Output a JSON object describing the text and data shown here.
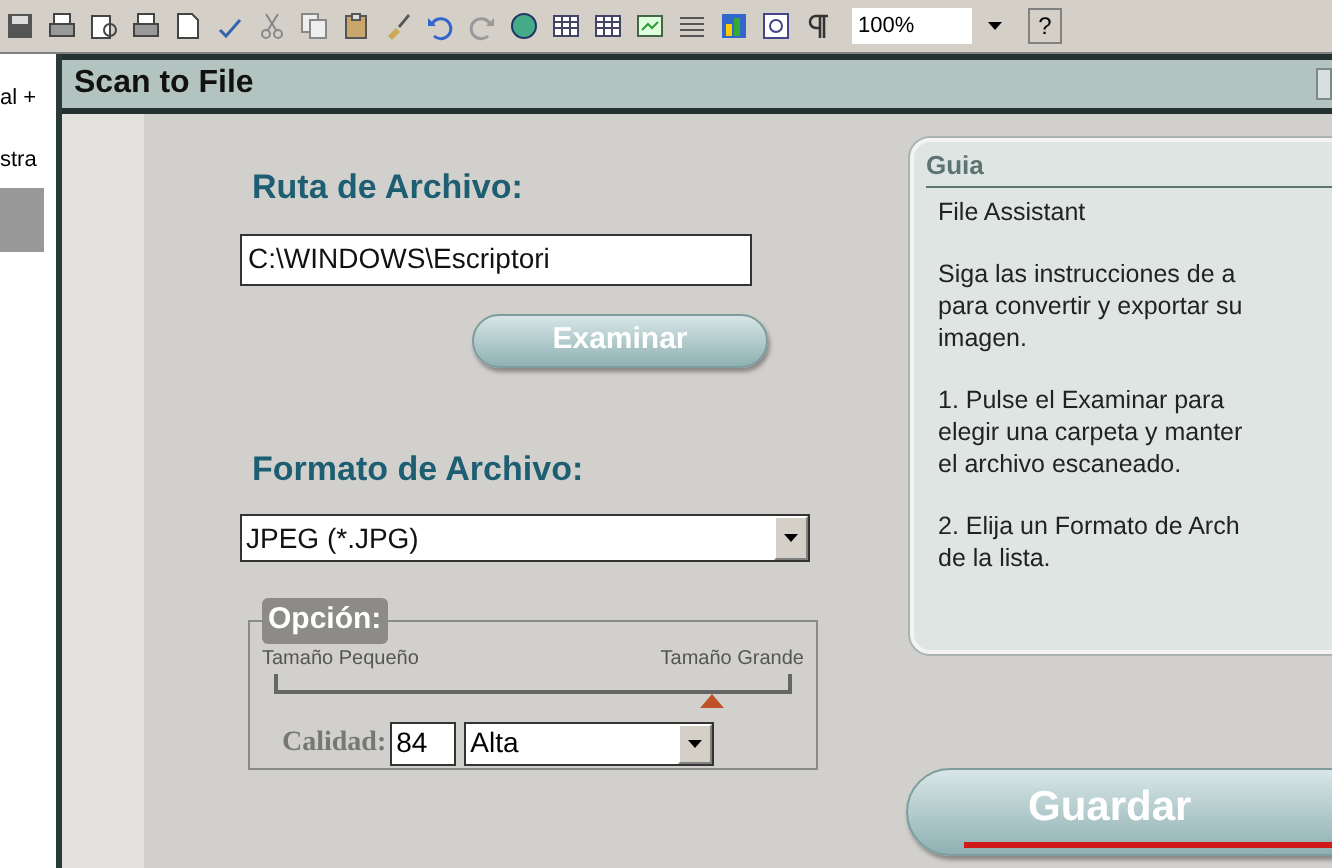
{
  "toolbar": {
    "zoom": "100%",
    "help": "?"
  },
  "background_document": {
    "texts": [
      "al +",
      "stra"
    ]
  },
  "window": {
    "title": "Scan to File"
  },
  "path": {
    "label": "Ruta de Archivo:",
    "value": "C:\\WINDOWS\\Escriptori",
    "button": "Examinar"
  },
  "format": {
    "label": "Formato de Archivo:",
    "value": "JPEG (*.JPG)"
  },
  "option": {
    "legend": "Opción:",
    "small_label": "Tamaño Pequeño",
    "large_label": "Tamaño Grande",
    "level": 0.85,
    "quality_label": "Calidad:",
    "quality_value": "84",
    "quality_preset": "Alta"
  },
  "guide": {
    "title": "Guia",
    "paragraphs": [
      [
        "File Assistant"
      ],
      [
        "Siga las instrucciones de a",
        "para convertir y exportar su",
        "imagen."
      ],
      [
        "1. Pulse el Examinar para",
        "elegir una carpeta y manter",
        "el archivo escaneado."
      ],
      [
        "2. Elija un Formato de Arch",
        "de la lista."
      ]
    ]
  },
  "save_button": "Guardar"
}
